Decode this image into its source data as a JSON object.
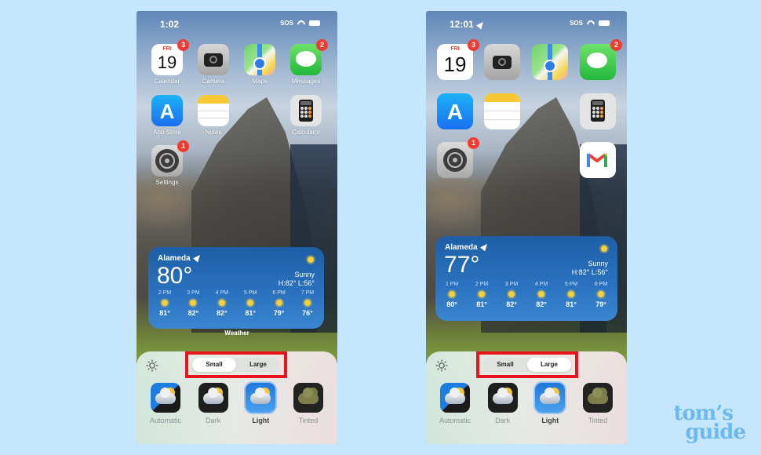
{
  "colors": {
    "page_bg": "#c5e6fd",
    "highlight_box": "#e8131f",
    "badge": "#f23a30",
    "weather_widget": "#2b73c0",
    "logo": "#6bb9ee"
  },
  "screens": [
    {
      "status": {
        "time": "1:02",
        "sos": "SOS",
        "location_arrow": false
      },
      "apps": [
        {
          "id": "calendar",
          "label": "Calendar",
          "badge": "3",
          "day": "FRI",
          "date": "19"
        },
        {
          "id": "camera",
          "label": "Camera",
          "badge": null
        },
        {
          "id": "maps",
          "label": "Maps",
          "badge": null
        },
        {
          "id": "messages",
          "label": "Messages",
          "badge": "2"
        },
        {
          "id": "app-store",
          "label": "App Store",
          "badge": null
        },
        {
          "id": "notes",
          "label": "Notes",
          "badge": null
        },
        {
          "id": "calculator",
          "label": "Calculator",
          "badge": null
        },
        {
          "id": "settings",
          "label": "Settings",
          "badge": "1"
        }
      ],
      "weather": {
        "city": "Alameda",
        "temp": "80°",
        "condition": "Sunny",
        "hi_lo": "H:82° L:56°",
        "hours": [
          {
            "time": "2 PM",
            "temp": "81°",
            "icon": "sun-icon"
          },
          {
            "time": "3 PM",
            "temp": "82°",
            "icon": "sun-icon"
          },
          {
            "time": "4 PM",
            "temp": "82°",
            "icon": "sun-icon"
          },
          {
            "time": "5 PM",
            "temp": "81°",
            "icon": "sun-icon"
          },
          {
            "time": "6 PM",
            "temp": "79°",
            "icon": "sun-icon"
          },
          {
            "time": "7 PM",
            "temp": "76°",
            "icon": "sun-icon"
          }
        ],
        "widget_label": "Weather"
      },
      "sheet": {
        "size_options": [
          "Small",
          "Large"
        ],
        "selected_size": "Small",
        "styles": [
          {
            "label": "Automatic"
          },
          {
            "label": "Dark"
          },
          {
            "label": "Light"
          },
          {
            "label": "Tinted"
          }
        ],
        "selected_style": "Light"
      }
    },
    {
      "status": {
        "time": "12:01",
        "sos": "SOS",
        "location_arrow": true
      },
      "apps": [
        {
          "id": "calendar",
          "label": "",
          "badge": "3",
          "day": "FRI",
          "date": "19"
        },
        {
          "id": "camera",
          "label": "",
          "badge": null
        },
        {
          "id": "maps",
          "label": "",
          "badge": null
        },
        {
          "id": "messages",
          "label": "",
          "badge": "2"
        },
        {
          "id": "app-store",
          "label": "",
          "badge": null
        },
        {
          "id": "notes",
          "label": "",
          "badge": null
        },
        {
          "id": "calculator",
          "label": "",
          "badge": null
        },
        {
          "id": "settings",
          "label": "",
          "badge": "1"
        },
        {
          "id": "gmail",
          "label": "",
          "badge": null
        }
      ],
      "weather": {
        "city": "Alameda",
        "temp": "77°",
        "condition": "Sunny",
        "hi_lo": "H:82° L:56°",
        "hours": [
          {
            "time": "1 PM",
            "temp": "80°",
            "icon": "sun-icon"
          },
          {
            "time": "2 PM",
            "temp": "81°",
            "icon": "sun-icon"
          },
          {
            "time": "3 PM",
            "temp": "82°",
            "icon": "sun-icon"
          },
          {
            "time": "4 PM",
            "temp": "82°",
            "icon": "sun-icon"
          },
          {
            "time": "5 PM",
            "temp": "81°",
            "icon": "sun-icon"
          },
          {
            "time": "6 PM",
            "temp": "79°",
            "icon": "sun-icon"
          }
        ]
      },
      "sheet": {
        "size_options": [
          "Small",
          "Large"
        ],
        "selected_size": "Large",
        "styles": [
          {
            "label": "Automatic"
          },
          {
            "label": "Dark"
          },
          {
            "label": "Light"
          },
          {
            "label": "Tinted"
          }
        ],
        "selected_style": "Light"
      }
    }
  ],
  "watermark": {
    "line1": "tom’s",
    "line2": "guide"
  }
}
